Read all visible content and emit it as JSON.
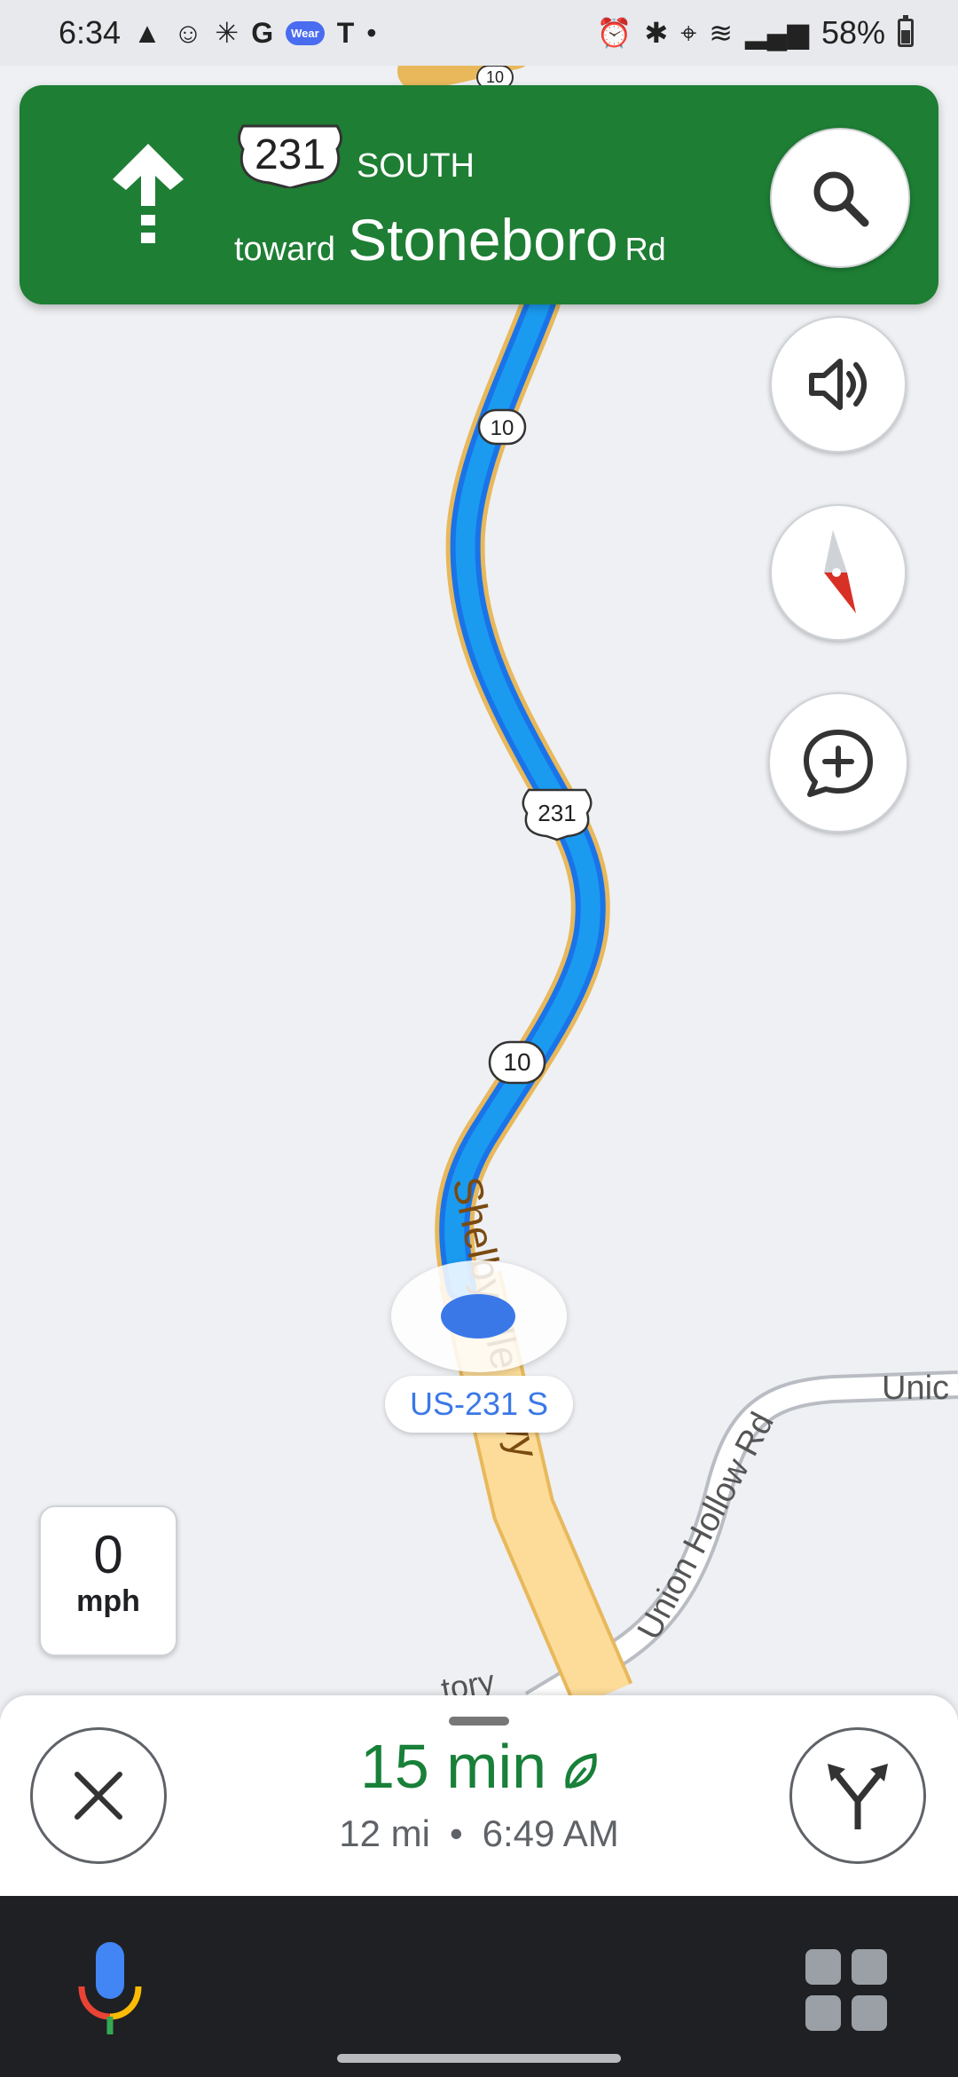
{
  "status_bar": {
    "time": "6:34",
    "battery": "58%"
  },
  "banner": {
    "route_number": "231",
    "direction": "SOUTH",
    "toward_word": "toward",
    "street_name": "Stoneboro",
    "street_suffix": "Rd",
    "maneuver_icon": "straight-arrow-icon",
    "color": "#1e7e34"
  },
  "map": {
    "route_shields": [
      "231",
      "10",
      "10",
      "231",
      "10"
    ],
    "road_label_hwy": "Shelbyville Hwy",
    "road_label_union": "Union Hollow Rd",
    "road_label_union_edge": "Unic",
    "road_label_partial": "tory",
    "current_route_label": "US-231 S",
    "route_color": "#1a73e8"
  },
  "speed": {
    "value": "0",
    "unit": "mph"
  },
  "trip": {
    "duration": "15 min",
    "distance": "12 mi",
    "arrival": "6:49 AM",
    "separator": "•"
  }
}
